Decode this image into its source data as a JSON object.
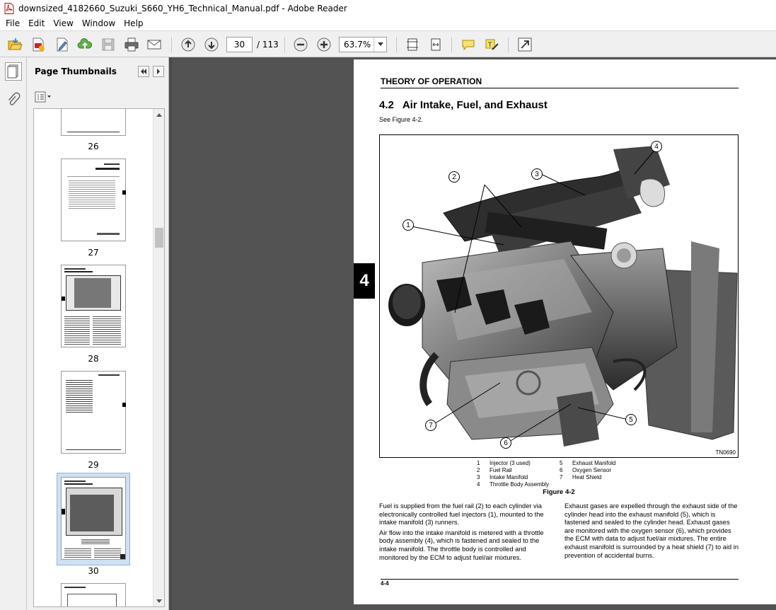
{
  "window": {
    "title": "downsized_4182660_Suzuki_S660_YH6_Technical_Manual.pdf - Adobe Reader"
  },
  "menu": [
    "File",
    "Edit",
    "View",
    "Window",
    "Help"
  ],
  "toolbar": {
    "current_page": "30",
    "total_pages": "/ 113",
    "zoom": "63.7%"
  },
  "sidebar": {
    "title": "Page Thumbnails",
    "thumbnails": [
      {
        "label": "26"
      },
      {
        "label": "27"
      },
      {
        "label": "28"
      },
      {
        "label": "29"
      },
      {
        "label": "30",
        "selected": true
      }
    ]
  },
  "document": {
    "header": "THEORY OF OPERATION",
    "section_number": "4.2",
    "section_title": "Air Intake, Fuel, and Exhaust",
    "see_figure": "See Figure 4-2.",
    "chapter_tab": "4",
    "figure_code": "TN0690",
    "callouts": [
      "1",
      "2",
      "3",
      "4",
      "5",
      "6",
      "7"
    ],
    "legend_left": [
      {
        "n": "1",
        "text": "Injector (3 used)"
      },
      {
        "n": "2",
        "text": "Fuel Rail"
      },
      {
        "n": "3",
        "text": "Intake Manifold"
      },
      {
        "n": "4",
        "text": "Throttle Body Assembly"
      }
    ],
    "legend_right": [
      {
        "n": "5",
        "text": "Exhaust Manifold"
      },
      {
        "n": "6",
        "text": "Oxygen Sensor"
      },
      {
        "n": "7",
        "text": "Heat Shield"
      }
    ],
    "figure_caption": "Figure 4-2",
    "left_col": [
      "Fuel is supplied from the fuel rail (2) to each cylinder via electronically controlled fuel injectors (1), mounted to the intake manifold (3) runners.",
      "Air flow into the intake manifold is metered with a throttle body assembly (4), which is fastened and sealed to the intake manifold. The throttle body is controlled and monitored by the ECM to adjust fuel/air mixtures."
    ],
    "right_col": [
      "Exhaust gases are expelled through the exhaust side of the cylinder head into the exhaust manifold (5), which is fastened and sealed to the cylinder head. Exhaust gases are monitored with the oxygen sensor (6), which provides the ECM with data to adjust fuel/air mixtures. The entire exhaust manifold is surrounded by a heat shield (7) to aid in prevention of accidental burns."
    ],
    "page_number": "4-4"
  }
}
